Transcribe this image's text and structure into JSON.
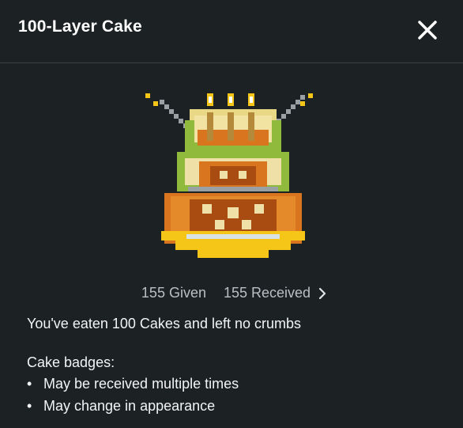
{
  "header": {
    "title": "100-Layer Cake",
    "close_icon": "close-icon"
  },
  "badge": {
    "icon": "pixel-cake-trophy-icon",
    "colors": {
      "gold": "#f5c518",
      "orange": "#d8751e",
      "green": "#8fba3c",
      "dark": "#5a3a12",
      "cream": "#efe0a8"
    }
  },
  "stats": {
    "given": "155 Given",
    "received": "155 Received"
  },
  "description": "You've eaten 100 Cakes and left no crumbs",
  "subheading": "Cake badges:",
  "bullets": [
    {
      "text": "May be received multiple times"
    },
    {
      "text": "May change in appearance"
    }
  ]
}
